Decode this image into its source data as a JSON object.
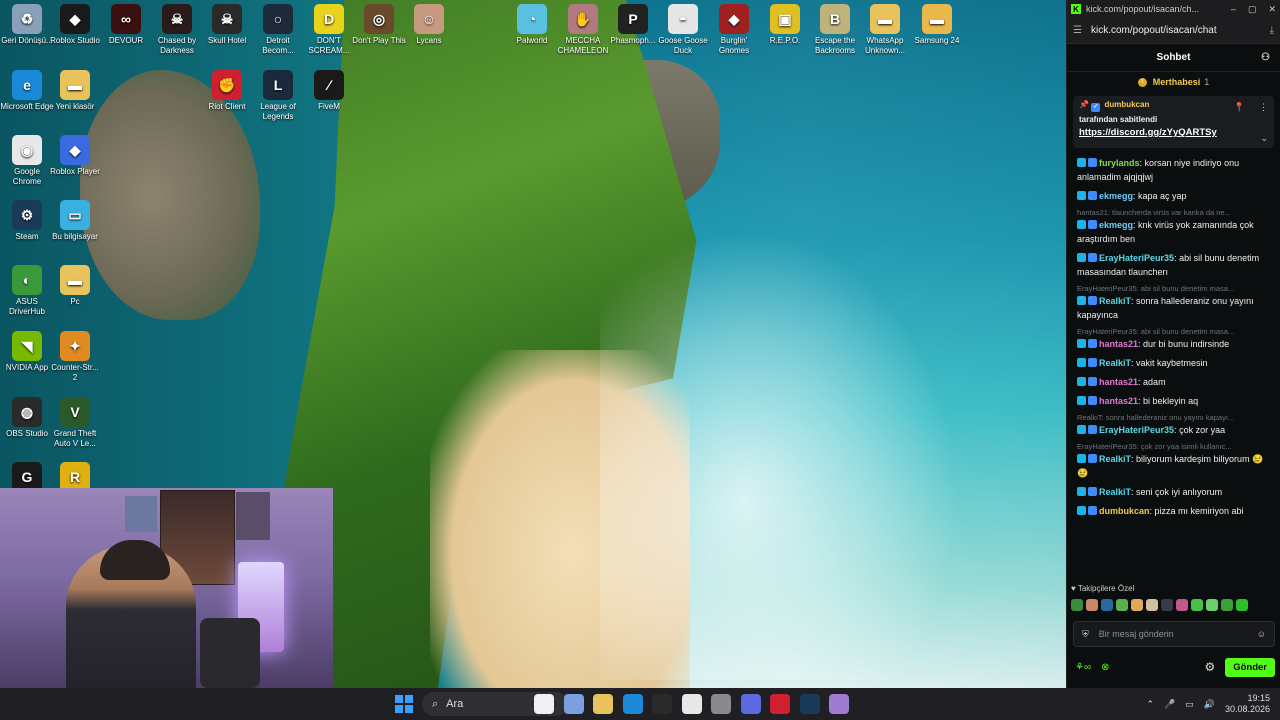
{
  "desktop": {
    "icons": [
      {
        "label": "Geri Dönüşü...",
        "color": "#8aa0b8",
        "glyph": "♻"
      },
      {
        "label": "Roblox Studio",
        "color": "#1a1a1a",
        "glyph": "◆"
      },
      {
        "label": "DEVOUR",
        "color": "#3a1010",
        "glyph": "∞"
      },
      {
        "label": "Chased by Darkness",
        "color": "#2a1a1a",
        "glyph": "☠"
      },
      {
        "label": "Skull Hotel",
        "color": "#2a2a2a",
        "glyph": "☠"
      },
      {
        "label": "Detroit Becom...",
        "color": "#1e2a3a",
        "glyph": "○"
      },
      {
        "label": "DON'T SCREAM...",
        "color": "#e8d21a",
        "glyph": "D"
      },
      {
        "label": "Don't Play This",
        "color": "#6a4a2a",
        "glyph": "◎"
      },
      {
        "label": "Lycans",
        "color": "#c79a80",
        "glyph": "☺"
      },
      {
        "label": "Palworld",
        "color": "#5ac0e0",
        "glyph": "◔"
      },
      {
        "label": "MECCHA CHAMELEON",
        "color": "#b07a80",
        "glyph": "✋"
      },
      {
        "label": "Phasmoph...",
        "color": "#222",
        "glyph": "P"
      },
      {
        "label": "Goose Goose Duck",
        "color": "#e6e6e6",
        "glyph": "◓"
      },
      {
        "label": "Burglin' Gnomes",
        "color": "#a02020",
        "glyph": "◆"
      },
      {
        "label": "R.E.P.O.",
        "color": "#e0c020",
        "glyph": "▣"
      },
      {
        "label": "Escape the Backrooms",
        "color": "#bfb27a",
        "glyph": "B"
      },
      {
        "label": "WhatsApp Unknown...",
        "color": "#e8c25a",
        "glyph": "▬"
      },
      {
        "label": "Samsung 24",
        "color": "#e8b84a",
        "glyph": "▬"
      },
      {
        "label": "Microsoft Edge",
        "color": "#1a8ad8",
        "glyph": "e"
      },
      {
        "label": "Yeni klasör",
        "color": "#e8c25a",
        "glyph": "▬"
      },
      {
        "label": "Riot Client",
        "color": "#d02030",
        "glyph": "✊"
      },
      {
        "label": "League of Legends",
        "color": "#1a2a3a",
        "glyph": "L"
      },
      {
        "label": "FiveM",
        "color": "#1a1a1a",
        "glyph": "∕"
      },
      {
        "label": "Google Chrome",
        "color": "#e8e8e8",
        "glyph": "◉"
      },
      {
        "label": "Roblox Player",
        "color": "#3a6ae0",
        "glyph": "◆"
      },
      {
        "label": "Steam",
        "color": "#1a3a5a",
        "glyph": "⚙"
      },
      {
        "label": "Bu bilgisayar",
        "color": "#3ab0e0",
        "glyph": "▭"
      },
      {
        "label": "ASUS DriverHub",
        "color": "#3a9a3a",
        "glyph": "◐"
      },
      {
        "label": "Pc",
        "color": "#e8c25a",
        "glyph": "▬"
      },
      {
        "label": "NVIDIA App",
        "color": "#76b900",
        "glyph": "◥"
      },
      {
        "label": "Counter-Str... 2",
        "color": "#e08a20",
        "glyph": "✦"
      },
      {
        "label": "OBS Studio",
        "color": "#2a2a2a",
        "glyph": "◍"
      },
      {
        "label": "Grand Theft Auto V Le...",
        "color": "#2a5a2a",
        "glyph": "V"
      },
      {
        "label": "",
        "color": "#1a1a1a",
        "glyph": "G"
      },
      {
        "label": "",
        "color": "#e0b010",
        "glyph": "R"
      }
    ]
  },
  "taskbar": {
    "search_placeholder": "Ara",
    "time": "19:15",
    "date": "30.08.2026",
    "app_colors": [
      "#f0f0f0",
      "#7aa0e0",
      "#e8c25a",
      "#1a8ad8",
      "#2a2a2a",
      "#e8e8e8",
      "#8a8a8a",
      "#5a6ae0",
      "#d02030",
      "#1a3a5a",
      "#a07ad0"
    ]
  },
  "chat": {
    "window_title": "kick.com/popout/isacan/ch...",
    "url": "kick.com/popout/isacan/chat",
    "header_title": "Sohbet",
    "banner_label": "Merthabesi",
    "banner_count": "1",
    "pinned": {
      "user": "dumbukcan",
      "by_text": "tarafından sabitlendi",
      "link": "https://discord.gg/zYyQARTSy"
    },
    "messages": [
      {
        "reply": "",
        "user": "furylands",
        "color": "#7ee04a",
        "text": "korsan niye indiriyo onu anlamadim ajqjqjwj"
      },
      {
        "reply": "",
        "user": "ekmegg",
        "color": "#6ad0ff",
        "text": "kapa aç yap"
      },
      {
        "reply": "hantas21: tlauncherda virüs var kanka da ne...",
        "user": "ekmegg",
        "color": "#6ad0ff",
        "text": "knk virüs yok zamanında çok araştırdım ben"
      },
      {
        "reply": "",
        "user": "ErayHateriPeur35",
        "color": "#5ad8e8",
        "text": "abi sil bunu denetim masasından tlaunchеrı"
      },
      {
        "reply": "ErayHateriPeur35: abi sil bunu denetim masa...",
        "user": "RealkiT",
        "color": "#5ad8e8",
        "text": "sonra hallederaniz onu yayını kapayınca"
      },
      {
        "reply": "ErayHateriPeur35: abi sil bunu denetim masa...",
        "user": "hantas21",
        "color": "#e07ad0",
        "text": "dur bi bunu indirsinde"
      },
      {
        "reply": "",
        "user": "RealkiT",
        "color": "#5ad8e8",
        "text": "vakit kaybetmesin"
      },
      {
        "reply": "",
        "user": "hantas21",
        "color": "#e07ad0",
        "text": "adam"
      },
      {
        "reply": "",
        "user": "hantas21",
        "color": "#e07ad0",
        "text": "bi bekleyin aq"
      },
      {
        "reply": "RealkiT: sonra hallederaniz onu yayını kapayı...",
        "user": "ErayHateriPeur35",
        "color": "#5ad8e8",
        "text": "çok zor yaa"
      },
      {
        "reply": "ErayHateriPeur35: çok zor yaa isimli kullanıc...",
        "user": "RealkiT",
        "color": "#5ad8e8",
        "text": "biliyorum kardeşim biliyorum 😢😢"
      },
      {
        "reply": "",
        "user": "RealkiT",
        "color": "#5ad8e8",
        "text": "seni çok iyi anlıyorum"
      },
      {
        "reply": "",
        "user": "dumbukcan",
        "color": "#f5c94f",
        "text": "pizza mı kemiriyon abi"
      }
    ],
    "followers_title": "Takipçilere Özel",
    "input_placeholder": "Bir mesaj gönderin",
    "send_label": "Gönder"
  }
}
